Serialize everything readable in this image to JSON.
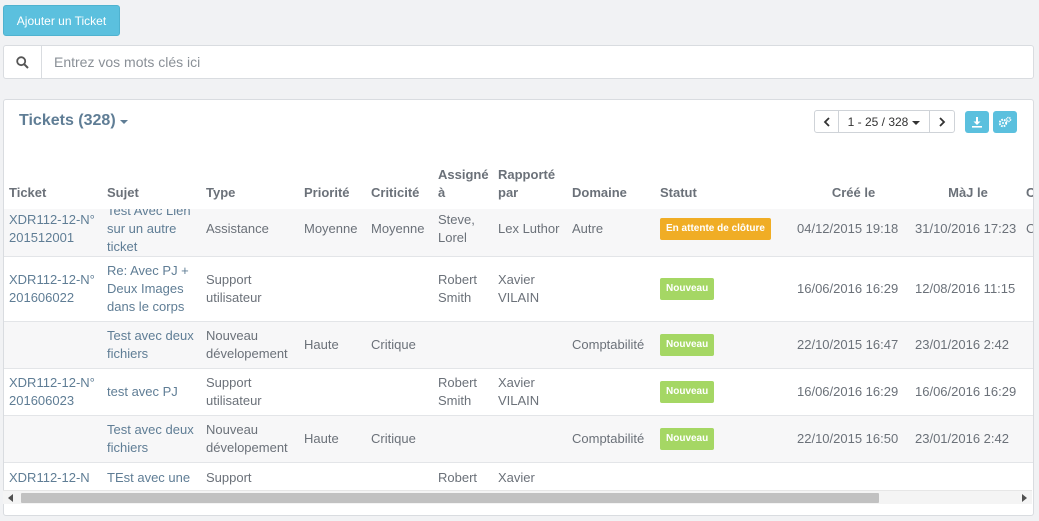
{
  "toolbar": {
    "add_ticket_label": "Ajouter un Ticket"
  },
  "search": {
    "placeholder": "Entrez vos mots clés ici",
    "icon": "search-icon"
  },
  "panel": {
    "title": "Tickets (328)",
    "pager": {
      "range": "1 - 25 / 328"
    },
    "icons": {
      "download": "download-icon",
      "settings": "settings-icon"
    }
  },
  "colors": {
    "accent": "#5bc0de",
    "title": "#5f7d95",
    "badge_waiting": "#f0ad25",
    "badge_new": "#a5d764"
  },
  "table": {
    "columns": [
      "Ticket",
      "Sujet",
      "Type",
      "Priorité",
      "Criticité",
      "Assigné à",
      "Rapporté par",
      "Domaine",
      "Statut",
      "Créé le",
      "MàJ le",
      "C"
    ],
    "rows": [
      {
        "ticket": "XDR112-12-N°201512001",
        "sujet": "Test Avec Lien sur un autre ticket",
        "type": "Assistance",
        "priorite": "Moyenne",
        "criticite": "Moyenne",
        "assigne": "Steve, Lorel",
        "rapporte": "Lex Luthor",
        "domaine": "Autre",
        "statut": "En attente de clôture",
        "cree": "04/12/2015 19:18",
        "maj": "31/10/2016 17:23",
        "extra": "C"
      },
      {
        "ticket": "XDR112-12-N°201606022",
        "sujet": "Re: Avec PJ + Deux Images dans le corps",
        "type": "Support utilisateur",
        "priorite": "",
        "criticite": "",
        "assigne": "Robert Smith",
        "rapporte": "Xavier VILAIN",
        "domaine": "",
        "statut": "Nouveau",
        "cree": "16/06/2016 16:29",
        "maj": "12/08/2016 11:15",
        "extra": ""
      },
      {
        "ticket": "",
        "sujet": "Test avec deux fichiers",
        "type": "Nouveau dévelopement",
        "priorite": "Haute",
        "criticite": "Critique",
        "assigne": "",
        "rapporte": "",
        "domaine": "Comptabilité",
        "statut": "Nouveau",
        "cree": "22/10/2015 16:47",
        "maj": "23/01/2016 2:42",
        "extra": ""
      },
      {
        "ticket": "XDR112-12-N°201606023",
        "sujet": "test avec PJ",
        "type": "Support utilisateur",
        "priorite": "",
        "criticite": "",
        "assigne": "Robert Smith",
        "rapporte": "Xavier VILAIN",
        "domaine": "",
        "statut": "Nouveau",
        "cree": "16/06/2016 16:29",
        "maj": "16/06/2016 16:29",
        "extra": ""
      },
      {
        "ticket": "",
        "sujet": "Test avec deux fichiers",
        "type": "Nouveau dévelopement",
        "priorite": "Haute",
        "criticite": "Critique",
        "assigne": "",
        "rapporte": "",
        "domaine": "Comptabilité",
        "statut": "Nouveau",
        "cree": "22/10/2015 16:50",
        "maj": "23/01/2016 2:42",
        "extra": ""
      },
      {
        "ticket": "XDR112-12-N",
        "sujet": "TEst avec une",
        "type": "Support",
        "priorite": "",
        "criticite": "",
        "assigne": "Robert",
        "rapporte": "Xavier",
        "domaine": "",
        "statut": "",
        "cree": "",
        "maj": "",
        "extra": ""
      }
    ]
  }
}
